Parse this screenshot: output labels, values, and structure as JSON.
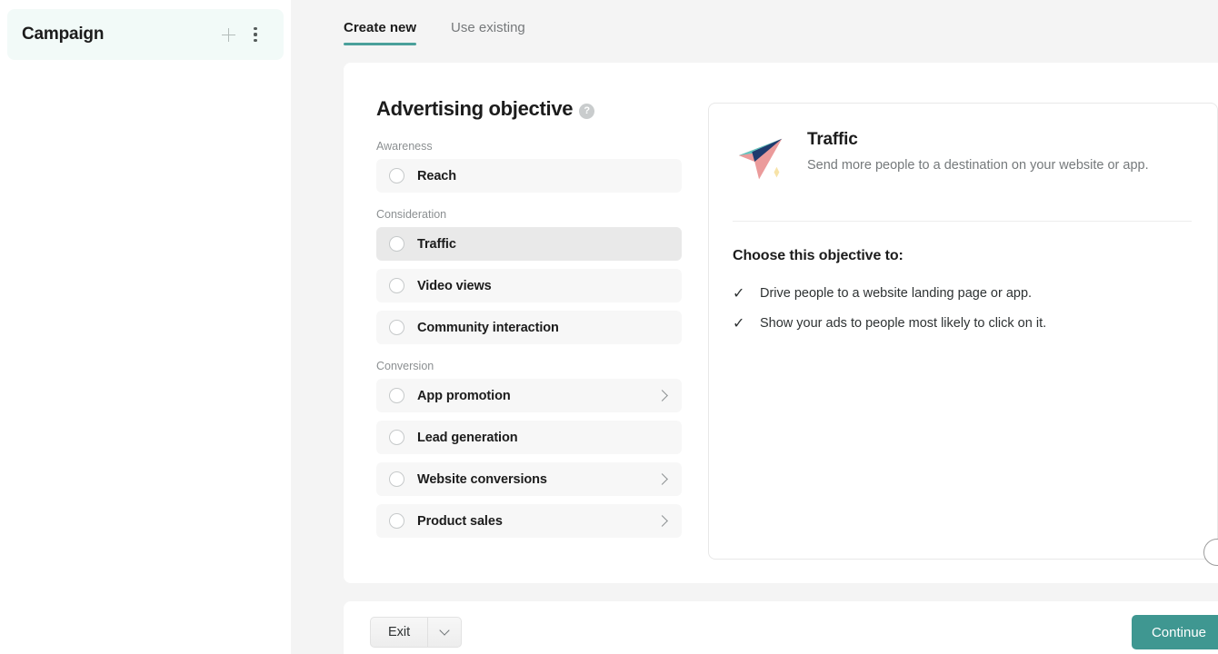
{
  "sidebar": {
    "title": "Campaign",
    "add_icon": "plus-icon",
    "more_icon": "kebab-menu-icon"
  },
  "tabs": [
    {
      "label": "Create new",
      "active": true
    },
    {
      "label": "Use existing",
      "active": false
    }
  ],
  "objective": {
    "heading": "Advertising objective",
    "help_icon": "?",
    "groups": [
      {
        "label": "Awareness",
        "options": [
          {
            "label": "Reach",
            "selected": false,
            "chevron": false
          }
        ]
      },
      {
        "label": "Consideration",
        "options": [
          {
            "label": "Traffic",
            "selected": true,
            "chevron": false
          },
          {
            "label": "Video views",
            "selected": false,
            "chevron": false
          },
          {
            "label": "Community interaction",
            "selected": false,
            "chevron": false
          }
        ]
      },
      {
        "label": "Conversion",
        "options": [
          {
            "label": "App promotion",
            "selected": false,
            "chevron": true
          },
          {
            "label": "Lead generation",
            "selected": false,
            "chevron": false
          },
          {
            "label": "Website conversions",
            "selected": false,
            "chevron": true
          },
          {
            "label": "Product sales",
            "selected": false,
            "chevron": true
          }
        ]
      }
    ]
  },
  "detail": {
    "icon": "paper-plane-icon",
    "title": "Traffic",
    "description": "Send more people to a destination on your website or app.",
    "choose_title": "Choose this objective to:",
    "bullets": [
      {
        "check": "✓",
        "text": "Drive people to a website landing page or app."
      },
      {
        "check": "✓",
        "text": "Show your ads to people most likely to click on it."
      }
    ]
  },
  "footer": {
    "exit_label": "Exit",
    "exit_caret_icon": "chevron-down-icon",
    "continue_label": "Continue"
  },
  "colors": {
    "accent_teal": "#4aa09b",
    "continue_teal": "#3f9791",
    "sidebar_tint": "#f2faf8",
    "page_bg": "#f4f4f4",
    "option_bg": "#f7f7f7",
    "option_selected_bg": "#e9e9e9"
  }
}
